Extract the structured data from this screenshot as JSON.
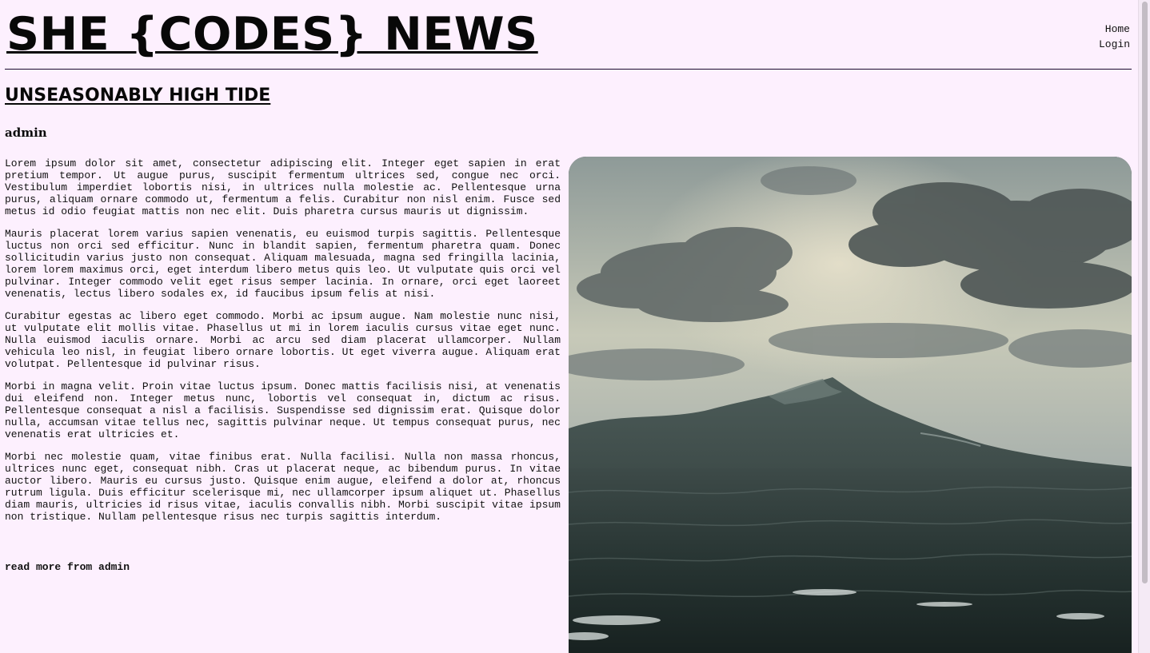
{
  "site": {
    "logo": "SHE {CODES} NEWS"
  },
  "nav": {
    "items": [
      {
        "label": "Home"
      },
      {
        "label": "Login"
      }
    ]
  },
  "article": {
    "title": "UNSEASONABLY HIGH TIDE",
    "author": "admin",
    "paragraphs": [
      "Lorem ipsum dolor sit amet, consectetur adipiscing elit. Integer eget sapien in erat pretium tempor. Ut augue purus, suscipit fermentum ultrices sed, congue nec orci. Vestibulum imperdiet lobortis nisi, in ultrices nulla molestie ac. Pellentesque urna purus, aliquam ornare commodo ut, fermentum a felis. Curabitur non nisl enim. Fusce sed metus id odio feugiat mattis non nec elit. Duis pharetra cursus mauris ut dignissim.",
      "Mauris placerat lorem varius sapien venenatis, eu euismod turpis sagittis. Pellentesque luctus non orci sed efficitur. Nunc in blandit sapien, fermentum pharetra quam. Donec sollicitudin varius justo non consequat. Aliquam malesuada, magna sed fringilla lacinia, lorem lorem maximus orci, eget interdum libero metus quis leo. Ut vulputate quis orci vel pulvinar. Integer commodo velit eget risus semper lacinia. In ornare, orci eget laoreet venenatis, lectus libero sodales ex, id faucibus ipsum felis at nisi.",
      "Curabitur egestas ac libero eget commodo. Morbi ac ipsum augue. Nam molestie nunc nisi, ut vulputate elit mollis vitae. Phasellus ut mi in lorem iaculis cursus vitae eget nunc. Nulla euismod iaculis ornare. Morbi ac arcu sed diam placerat ullamcorper. Nullam vehicula leo nisl, in feugiat libero ornare lobortis. Ut eget viverra augue. Aliquam erat volutpat. Pellentesque id pulvinar risus.",
      "Morbi in magna velit. Proin vitae luctus ipsum. Donec mattis facilisis nisi, at venenatis dui eleifend non. Integer metus nunc, lobortis vel consequat in, dictum ac risus. Pellentesque consequat a nisl a facilisis. Suspendisse sed dignissim erat. Quisque dolor nulla, accumsan vitae tellus nec, sagittis pulvinar neque. Ut tempus consequat purus, nec venenatis erat ultricies et.",
      "Morbi nec molestie quam, vitae finibus erat. Nulla facilisi. Nulla non massa rhoncus, ultrices nunc eget, consequat nibh. Cras ut placerat neque, ac bibendum purus. In vitae auctor libero. Mauris eu cursus justo. Quisque enim augue, eleifend a dolor at, rhoncus rutrum ligula. Duis efficitur scelerisque mi, nec ullamcorper ipsum aliquet ut. Phasellus diam mauris, ultricies id risus vitae, iaculis convallis nibh. Morbi suscipit vitae ipsum non tristique. Nullam pellentesque risus nec turpis sagittis interdum."
    ],
    "read_more": "read more from admin",
    "image": {
      "subject": "stormy-sea-wave-photo"
    }
  },
  "colors": {
    "background": "#fdf0fe",
    "text": "#111111",
    "divider": "#1a0a2e"
  }
}
